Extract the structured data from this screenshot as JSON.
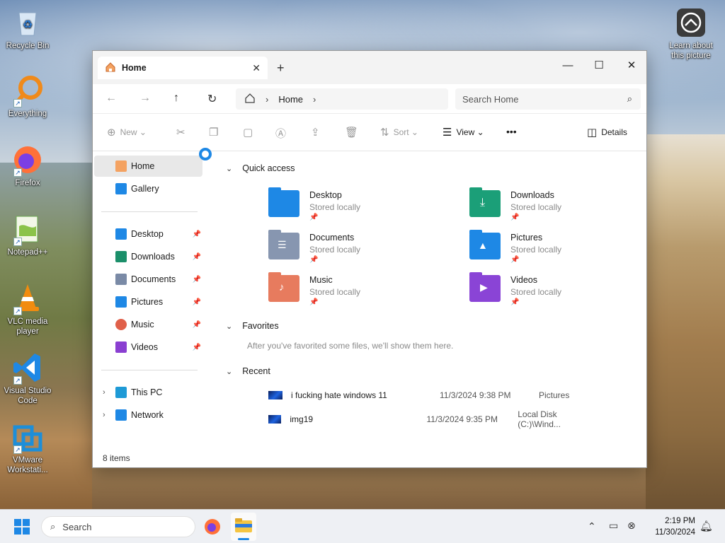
{
  "desktop": {
    "icons": [
      {
        "label": "Recycle Bin"
      },
      {
        "label": "Everything"
      },
      {
        "label": "Firefox"
      },
      {
        "label": "Notepad++"
      },
      {
        "label": "VLC media player"
      },
      {
        "label": "Visual Studio Code"
      },
      {
        "label": "VMware Workstati..."
      }
    ],
    "learn_label": "Learn about this picture"
  },
  "window": {
    "tab_title": "Home",
    "tab_close_icon": "close-icon",
    "new_tab_label": "+",
    "address": {
      "location": "Home"
    },
    "search_placeholder": "Search Home",
    "commands": {
      "new_label": "New",
      "sort_label": "Sort",
      "view_label": "View",
      "more_label": "•••",
      "details_label": "Details"
    },
    "sidebar": {
      "top": [
        {
          "label": "Home",
          "icon": "home-icon",
          "color": "#e8743b",
          "selected": true
        },
        {
          "label": "Gallery",
          "icon": "gallery-icon",
          "color": "#1e88e5",
          "selected": false
        }
      ],
      "pinned": [
        {
          "label": "Desktop",
          "icon": "desktop-folder-icon",
          "color": "#1e88e5"
        },
        {
          "label": "Downloads",
          "icon": "download-icon",
          "color": "#1b8f6a"
        },
        {
          "label": "Documents",
          "icon": "documents-icon",
          "color": "#7a8aa6"
        },
        {
          "label": "Pictures",
          "icon": "pictures-icon",
          "color": "#1e88e5"
        },
        {
          "label": "Music",
          "icon": "music-icon",
          "color": "#e0604a"
        },
        {
          "label": "Videos",
          "icon": "videos-icon",
          "color": "#8a3fd1"
        }
      ],
      "bottom": [
        {
          "label": "This PC",
          "icon": "pc-icon",
          "color": "#1e9ad6"
        },
        {
          "label": "Network",
          "icon": "network-icon",
          "color": "#1e88e5"
        }
      ]
    },
    "quick_access_header": "Quick access",
    "quick_access": [
      {
        "name": "Desktop",
        "status": "Stored locally",
        "color": "#1e88e5"
      },
      {
        "name": "Downloads",
        "status": "Stored locally",
        "color": "#1b9f78"
      },
      {
        "name": "Documents",
        "status": "Stored locally",
        "color": "#8796b0"
      },
      {
        "name": "Pictures",
        "status": "Stored locally",
        "color": "#1e88e5"
      },
      {
        "name": "Music",
        "status": "Stored locally",
        "color": "#e77b5e"
      },
      {
        "name": "Videos",
        "status": "Stored locally",
        "color": "#8a44d6"
      }
    ],
    "favorites_header": "Favorites",
    "favorites_empty": "After you've favorited some files, we'll show them here.",
    "recent_header": "Recent",
    "recent": [
      {
        "name": "i fucking hate windows 11",
        "date": "11/3/2024 9:38 PM",
        "location": "Pictures"
      },
      {
        "name": "img19",
        "date": "11/3/2024 9:35 PM",
        "location": "Local Disk (C:)\\Wind..."
      }
    ],
    "status": "8 items"
  },
  "taskbar": {
    "search_label": "Search",
    "time": "2:19 PM",
    "date": "11/30/2024"
  }
}
